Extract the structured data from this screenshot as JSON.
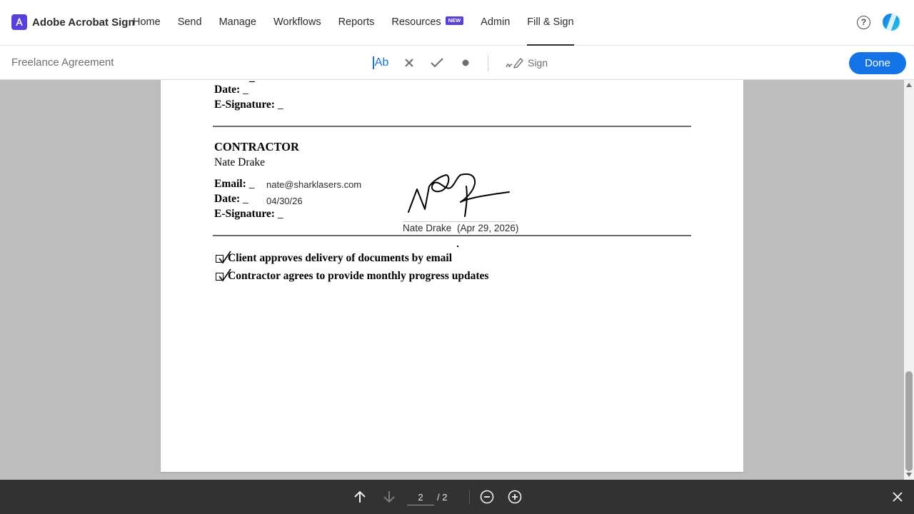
{
  "app": {
    "brand": "Adobe Acrobat Sign",
    "nav": [
      {
        "label": "Home"
      },
      {
        "label": "Send"
      },
      {
        "label": "Manage"
      },
      {
        "label": "Workflows"
      },
      {
        "label": "Reports"
      },
      {
        "label": "Resources",
        "badge": "NEW"
      },
      {
        "label": "Admin"
      },
      {
        "label": "Fill & Sign",
        "active": true
      }
    ],
    "help_symbol": "?"
  },
  "toolbar": {
    "doc_title": "Freelance Agreement",
    "text_tool": "Ab",
    "sign_label": "Sign",
    "done_label": "Done"
  },
  "document": {
    "top_fields": {
      "partial_line": "_",
      "date_label": "Date:",
      "date_blank": "_",
      "esig_label": "E-Signature:",
      "esig_blank": "_"
    },
    "contractor": {
      "heading": "CONTRACTOR",
      "name": "Nate Drake",
      "email_label": "Email:",
      "email_blank": "_",
      "email_value": "nate@sharklasers.com",
      "date_label": "Date:",
      "date_blank": "_",
      "date_value": "04/30/26",
      "esig_label": "E-Signature:",
      "esig_blank": "_",
      "signer_name": "Nate Drake",
      "signed_date": "(Apr 29, 2026)"
    },
    "checkboxes": [
      {
        "label": "Client approves delivery of documents by email",
        "checked": true
      },
      {
        "label": "Contractor agrees to provide monthly progress updates",
        "checked": true
      }
    ]
  },
  "pager": {
    "current_page": "2",
    "total_label": "/ 2"
  },
  "colors": {
    "accent": "#1473e6",
    "brand": "#5a3fd9",
    "viewer_bg": "#bdbdbd",
    "bottom_bar": "#323232"
  },
  "icons": [
    "acrobat-sign-logo-icon",
    "help-icon",
    "avatar",
    "text-tool-icon",
    "cross-icon",
    "checkmark-icon",
    "dot-icon",
    "sign-pen-icon",
    "arrow-up-icon",
    "arrow-down-icon",
    "zoom-out-icon",
    "zoom-in-icon",
    "close-icon"
  ]
}
